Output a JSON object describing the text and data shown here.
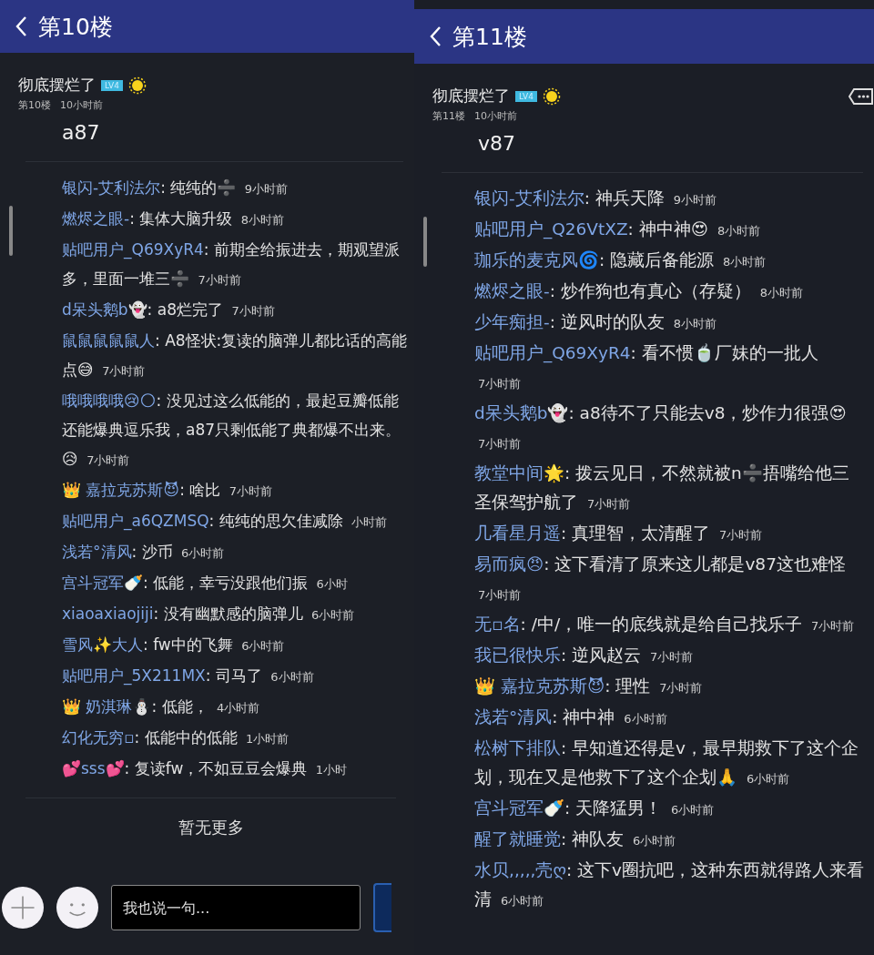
{
  "panels": [
    {
      "title": "第10楼",
      "author": {
        "name": "彻底摆烂了",
        "badge": "LV4",
        "floor": "第10楼",
        "time": "10小时前"
      },
      "more_button": false,
      "content": "a87",
      "comments": [
        {
          "user": "银闪-艾利法尔",
          "message": ": 纯纯的➗",
          "time": "9小时前"
        },
        {
          "user": "燃烬之眼-",
          "message": ": 集体大脑升级",
          "time": "8小时前"
        },
        {
          "user": "贴吧用户_Q69XyR4",
          "message": ": 前期全给振进去，期观望派多，里面一堆三➗",
          "time": "7小时前"
        },
        {
          "user": "d呆头鹅b👻",
          "message": ": a8烂完了",
          "time": "7小时前"
        },
        {
          "user": "鼠鼠鼠鼠鼠人",
          "message": ": A8怪状:复读的脑弹儿都比话的高能点😅",
          "time": "7小时前"
        },
        {
          "user": "哦哦哦哦😢🌕",
          "message": ": 没见过这么低能的，最起豆瓣低能还能爆典逗乐我，a87只剩低能了典都爆不出来。😥",
          "time": "7小时前"
        },
        {
          "user": "👑 嘉拉克苏斯😈",
          "message": ": 啥比",
          "time": "7小时前"
        },
        {
          "user": "贴吧用户_a6QZMSQ",
          "message": ": 纯纯的思欠佳减除",
          "time": "小时前"
        },
        {
          "user": "浅若°清风",
          "message": ": 沙币",
          "time": "6小时前"
        },
        {
          "user": "宫斗冠军🍼",
          "message": ": 低能，幸亏没跟他们振",
          "time": "6小时"
        },
        {
          "user": "xiaoaxiaojiji",
          "message": ": 没有幽默感的脑弹儿",
          "time": "6小时前"
        },
        {
          "user": "雪风✨大人",
          "message": ": fw中的飞舞",
          "time": "6小时前"
        },
        {
          "user": "贴吧用户_5X211MX",
          "message": ": 司马了",
          "time": "6小时前"
        },
        {
          "user": "👑 奶淇琳⛄",
          "message": ": 低能，",
          "time": "4小时前"
        },
        {
          "user": "幻化无穷▫",
          "message": ": 低能中的低能",
          "time": "1小时前"
        },
        {
          "user": "💕sss💕",
          "message": ": 复读fw，不如豆豆会爆典",
          "time": "1小时"
        }
      ],
      "footer": "暂无更多",
      "input": {
        "placeholder": "我也说一句..."
      }
    },
    {
      "title": "第11楼",
      "author": {
        "name": "彻底摆烂了",
        "badge": "LV4",
        "floor": "第11楼",
        "time": "10小时前"
      },
      "more_button": true,
      "content": "v87",
      "comments": [
        {
          "user": "银闪-艾利法尔",
          "message": ": 神兵天降",
          "time": "9小时前"
        },
        {
          "user": "贴吧用户_Q26VtXZ",
          "message": ": 神中神😍",
          "time": "8小时前"
        },
        {
          "user": "珈乐的麦克风🌀",
          "message": ": 隐藏后备能源",
          "time": "8小时前"
        },
        {
          "user": "燃烬之眼-",
          "message": ": 炒作狗也有真心（存疑）",
          "time": "8小时前"
        },
        {
          "user": "少年痴担-",
          "message": ": 逆风时的队友",
          "time": "8小时前"
        },
        {
          "user": "贴吧用户_Q69XyR4",
          "message": ": 看不惯🍵厂妹的一批人",
          "time": "7小时前"
        },
        {
          "user": "d呆头鹅b👻",
          "message": ": a8待不了只能去v8，炒作力很强😍",
          "time": "7小时前"
        },
        {
          "user": "教堂中间🌟",
          "message": ": 拨云见日，不然就被n➗捂嘴给他三圣保驾护航了",
          "time": "7小时前"
        },
        {
          "user": "几看星月遥",
          "message": ": 真理智，太清醒了",
          "time": "7小时前"
        },
        {
          "user": "易而疯😠",
          "message": ": 这下看清了原来这儿都是v87这也难怪",
          "time": "7小时前"
        },
        {
          "user": "无▫名",
          "message": ": /中/，唯一的底线就是给自己找乐子",
          "time": "7小时前"
        },
        {
          "user": "我已很快乐",
          "message": ": 逆风赵云",
          "time": "7小时前"
        },
        {
          "user": "👑 嘉拉克苏斯😈",
          "message": ": 理性",
          "time": "7小时前"
        },
        {
          "user": "浅若°清风",
          "message": ": 神中神",
          "time": "6小时前"
        },
        {
          "user": "松树下排队",
          "message": ": 早知道还得是v，最早期救下了这个企划，现在又是他救下了这个企划🙏",
          "time": "6小时前"
        },
        {
          "user": "宫斗冠军🍼",
          "message": ": 天降猛男！",
          "time": "6小时前"
        },
        {
          "user": "醒了就睡觉",
          "message": ": 神队友",
          "time": "6小时前"
        },
        {
          "user": "水贝,,,,,壳ღ",
          "message": ": 这下v圈抗吧，这种东西就得路人来看清",
          "time": "6小时前"
        }
      ]
    }
  ]
}
